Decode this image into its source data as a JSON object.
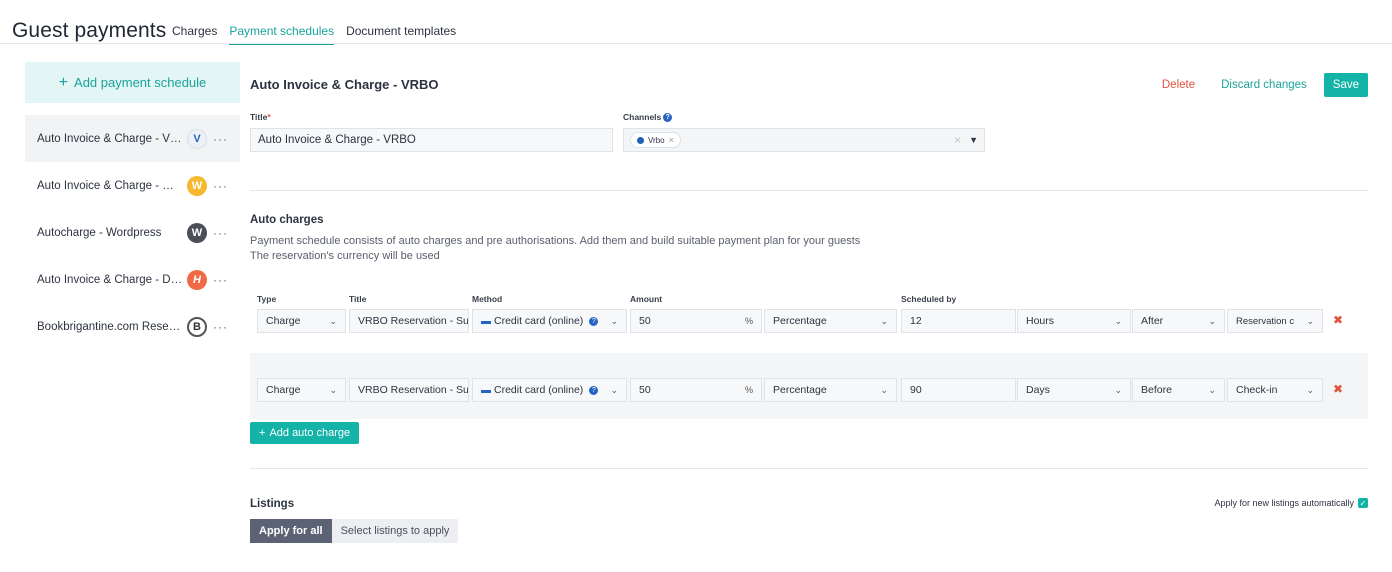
{
  "header": {
    "title": "Guest payments",
    "tabs": [
      {
        "label": "Charges"
      },
      {
        "label": "Payment schedules"
      },
      {
        "label": "Document templates"
      }
    ]
  },
  "sidebar": {
    "add_label": "Add payment schedule",
    "items": [
      {
        "name": "Auto Invoice & Charge - VRBO",
        "icon": "vrbo-icon",
        "icon_glyph": "V"
      },
      {
        "name": "Auto Invoice & Charge - Website",
        "icon": "website-icon",
        "icon_glyph": "W"
      },
      {
        "name": "Autocharge - Wordpress",
        "icon": "wordpress-icon",
        "icon_glyph": "W"
      },
      {
        "name": "Auto Invoice & Charge - Direct",
        "icon": "direct-icon",
        "icon_glyph": "H"
      },
      {
        "name": "Bookbrigantine.com Reservation",
        "icon": "booking-site-icon",
        "icon_glyph": "B"
      }
    ],
    "more_glyph": "···"
  },
  "form": {
    "heading": "Auto Invoice & Charge - VRBO",
    "delete_label": "Delete",
    "discard_label": "Discard changes",
    "save_label": "Save",
    "title_label": "Title",
    "title_required": "*",
    "title_value": "Auto Invoice & Charge  - VRBO",
    "channels_label": "Channels",
    "channels": [
      {
        "name": "Vrbo"
      }
    ]
  },
  "auto_charges": {
    "title": "Auto charges",
    "desc_line1": "Payment schedule consists of auto charges and pre authorisations. Add them and build suitable payment plan for your guests",
    "desc_line2": "The reservation's currency will be used",
    "columns": {
      "type": "Type",
      "title": "Title",
      "method": "Method",
      "amount": "Amount",
      "scheduled_by": "Scheduled by"
    },
    "rows": [
      {
        "type": "Charge",
        "title": "VRBO Reservation - Su",
        "method": "Credit card (online)",
        "amount": "50",
        "amount_unit": "Percentage",
        "schedule_value": "12",
        "schedule_unit": "Hours",
        "relation": "After",
        "anchor": "Reservation c"
      },
      {
        "type": "Charge",
        "title": "VRBO Reservation - Su",
        "method": "Credit card (online)",
        "amount": "50",
        "amount_unit": "Percentage",
        "schedule_value": "90",
        "schedule_unit": "Days",
        "relation": "Before",
        "anchor": "Check-in"
      }
    ],
    "add_label": "Add auto charge"
  },
  "listings": {
    "title": "Listings",
    "auto_apply_label": "Apply for new listings automatically",
    "auto_apply_checked": true,
    "apply_all_label": "Apply for all",
    "select_label": "Select listings to apply"
  },
  "colors": {
    "accent": "#14b3a8",
    "danger": "#e1523d"
  }
}
